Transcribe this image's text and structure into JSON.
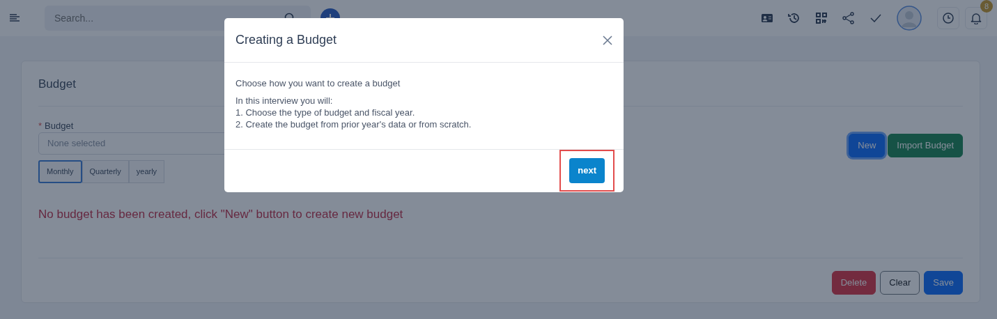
{
  "topbar": {
    "search": {
      "placeholder": "Search..."
    },
    "notification_count": "8"
  },
  "card": {
    "title": "Budget",
    "field": {
      "label": "Budget",
      "required_mark": "*",
      "placeholder": "None selected"
    },
    "periods": [
      {
        "label": "Monthly",
        "selected": true
      },
      {
        "label": "Quarterly",
        "selected": false
      },
      {
        "label": "yearly",
        "selected": false
      }
    ],
    "message": "No budget has been created, click \"New\" button to create new budget",
    "actions": [
      {
        "label": "New",
        "kind": "primary"
      },
      {
        "label": "Import Budget",
        "kind": "success"
      }
    ],
    "footer_buttons": [
      {
        "label": "Delete",
        "kind": "danger"
      },
      {
        "label": "Clear",
        "kind": "outline"
      },
      {
        "label": "Save",
        "kind": "primary"
      }
    ]
  },
  "modal": {
    "title": "Creating a Budget",
    "intro": "Choose how you want to create a budget",
    "lines": [
      "In this interview you will:",
      "1. Choose the type of budget and fiscal year.",
      "2. Create the budget from prior year's data or from scratch."
    ],
    "next_button": {
      "label": "next",
      "highlighted": true
    }
  }
}
